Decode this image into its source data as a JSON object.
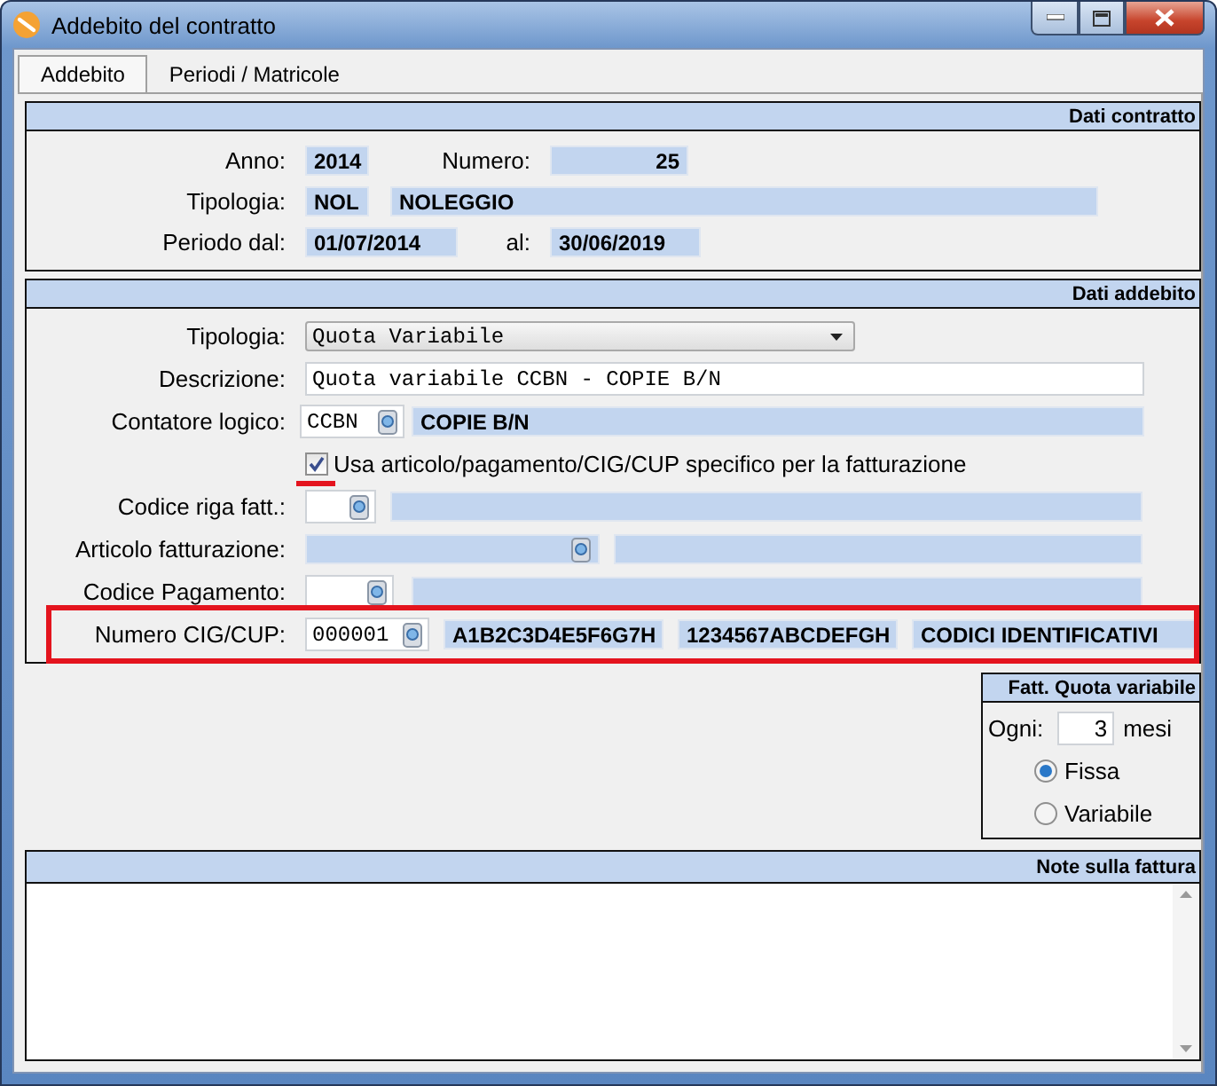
{
  "window": {
    "title": "Addebito del contratto"
  },
  "tabs": [
    {
      "label": "Addebito",
      "selected": true
    },
    {
      "label": "Periodi / Matricole",
      "selected": false
    }
  ],
  "dati_contratto": {
    "title": "Dati contratto",
    "rows": [
      {
        "items": [
          {
            "kind": "label",
            "text": "Anno:"
          },
          {
            "kind": "readonly",
            "value": "2014"
          },
          {
            "kind": "label",
            "text": "Numero:"
          },
          {
            "kind": "readonly-number",
            "value": "25"
          }
        ]
      },
      {
        "items": [
          {
            "kind": "label",
            "text": "Tipologia:"
          },
          {
            "kind": "readonly",
            "value": "NOL"
          },
          {
            "kind": "readonly",
            "value": "NOLEGGIO"
          }
        ]
      },
      {
        "items": [
          {
            "kind": "label",
            "text": "Periodo dal:"
          },
          {
            "kind": "readonly",
            "value": "01/07/2014"
          },
          {
            "kind": "label",
            "text": "al:"
          },
          {
            "kind": "readonly",
            "value": "30/06/2019"
          }
        ]
      }
    ]
  },
  "dati_addebito": {
    "title": "Dati addebito",
    "rows": [
      {
        "highlighted": false,
        "items": [
          {
            "kind": "label",
            "text": "Tipologia:"
          },
          {
            "kind": "select",
            "value": "Quota Variabile"
          }
        ]
      },
      {
        "highlighted": false,
        "items": [
          {
            "kind": "label",
            "text": "Descrizione:"
          },
          {
            "kind": "input",
            "value": "Quota variabile CCBN - COPIE B/N"
          }
        ]
      },
      {
        "highlighted": false,
        "items": [
          {
            "kind": "label",
            "text": "Contatore logico:"
          },
          {
            "kind": "lookup",
            "value": "CCBN"
          },
          {
            "kind": "readonly",
            "value": "COPIE B/N"
          }
        ]
      },
      {
        "highlighted": false,
        "items": [
          {
            "kind": "checkbox",
            "label": "Usa articolo/pagamento/CIG/CUP specifico per la fatturazione",
            "checked": true,
            "underlined": true
          }
        ]
      },
      {
        "highlighted": false,
        "items": [
          {
            "kind": "label",
            "text": "Codice riga fatt.:"
          },
          {
            "kind": "lookup",
            "value": ""
          },
          {
            "kind": "readonly",
            "value": ""
          }
        ]
      },
      {
        "highlighted": false,
        "items": [
          {
            "kind": "label",
            "text": "Articolo fatturazione:"
          },
          {
            "kind": "readonly-lookup",
            "value": ""
          },
          {
            "kind": "readonly",
            "value": ""
          }
        ]
      },
      {
        "highlighted": false,
        "items": [
          {
            "kind": "label",
            "text": "Codice Pagamento:"
          },
          {
            "kind": "lookup",
            "value": ""
          },
          {
            "kind": "readonly",
            "value": ""
          }
        ]
      },
      {
        "highlighted": true,
        "items": [
          {
            "kind": "label",
            "text": "Numero CIG/CUP:"
          },
          {
            "kind": "lookup",
            "value": "000001"
          },
          {
            "kind": "readonly",
            "value": "A1B2C3D4E5F6G7H"
          },
          {
            "kind": "readonly",
            "value": "1234567ABCDEFGH"
          },
          {
            "kind": "readonly",
            "value": "CODICI IDENTIFICATIVI"
          }
        ]
      }
    ]
  },
  "fatt_quota_variabile": {
    "title": "Fatt. Quota variabile",
    "every_label": "Ogni:",
    "every_value": "3",
    "every_unit": "mesi",
    "options": [
      {
        "label": "Fissa",
        "selected": true
      },
      {
        "label": "Variabile",
        "selected": false
      }
    ]
  },
  "note_sulla_fattura": {
    "title": "Note sulla fattura"
  }
}
